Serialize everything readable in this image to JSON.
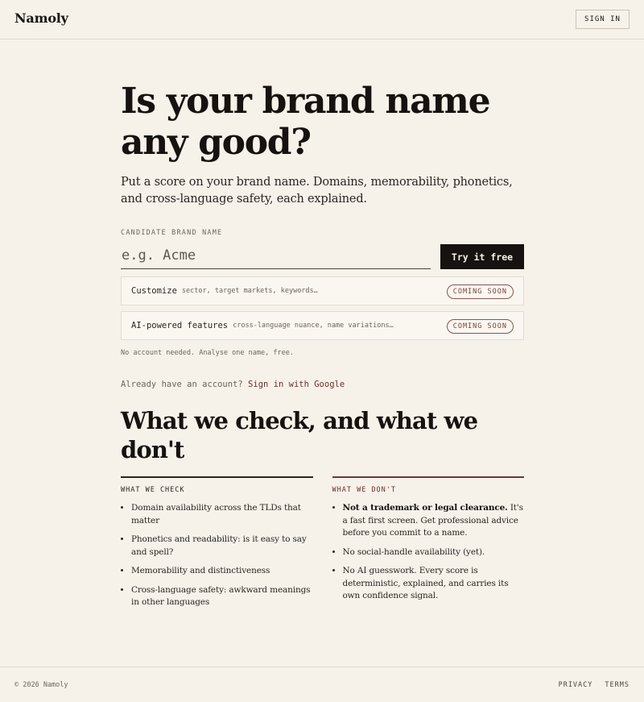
{
  "header": {
    "logo": "Namoly",
    "sign_in_label": "SIGN IN"
  },
  "hero": {
    "headline_line1": "Is your brand name",
    "headline_line2": "any good?",
    "subhead": "Put a score on your brand name. Domains, memorability, phonetics, and cross-language safety, each explained."
  },
  "form": {
    "field_label": "CANDIDATE BRAND NAME",
    "input_value": "",
    "input_placeholder": "e.g. Acme",
    "submit_label": "Try it free",
    "features": [
      {
        "title": "Customize",
        "hint": "sector, target markets, keywords…",
        "badge": "COMING SOON"
      },
      {
        "title": "AI-powered features",
        "hint": "cross-language nuance, name variations…",
        "badge": "COMING SOON"
      }
    ],
    "note": "No account needed. Analyse one name, free."
  },
  "account": {
    "prompt": "Already have an account?",
    "link_label": "Sign in with Google"
  },
  "checks": {
    "title": "What we check, and what we don't",
    "we_check": {
      "heading": "WHAT WE CHECK",
      "items": [
        "Domain availability across the TLDs that matter",
        "Phonetics and readability: is it easy to say and spell?",
        "Memorability and distinctiveness",
        "Cross-language safety: awkward meanings in other languages"
      ]
    },
    "we_dont": {
      "heading": "WHAT WE DON'T",
      "items": [
        {
          "bold": "Not a trademark or legal clearance.",
          "text": " It's a fast first screen. Get professional advice before you commit to a name."
        },
        {
          "bold": "",
          "text": "No social-handle availability (yet)."
        },
        {
          "bold": "",
          "text": "No AI guesswork. Every score is deterministic, explained, and carries its own confidence signal."
        }
      ]
    }
  },
  "footer": {
    "copyright": "© 2026 Namoly",
    "privacy_label": "PRIVACY",
    "terms_label": "TERMS"
  }
}
